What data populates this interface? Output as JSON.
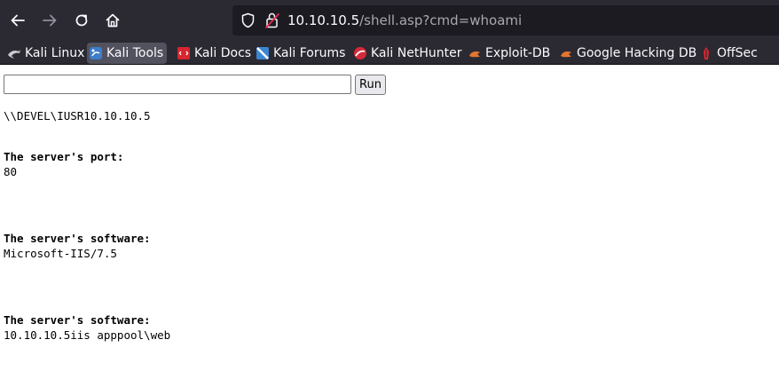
{
  "toolbar": {
    "back": "back-arrow",
    "forward": "forward-arrow",
    "reload": "reload",
    "home": "home",
    "url_host": "10.10.10.5",
    "url_path": "/shell.asp?cmd=whoami"
  },
  "bookmarks": [
    {
      "label": "Kali Linux",
      "icon": "kali-dragon-icon"
    },
    {
      "label": "Kali Tools",
      "icon": "kali-tools-icon",
      "active": true
    },
    {
      "label": "Kali Docs",
      "icon": "kali-docs-icon"
    },
    {
      "label": "Kali Forums",
      "icon": "kali-forums-icon"
    },
    {
      "label": "Kali NetHunter",
      "icon": "nethunter-icon"
    },
    {
      "label": "Exploit-DB",
      "icon": "exploit-db-icon"
    },
    {
      "label": "Google Hacking DB",
      "icon": "ghdb-icon"
    },
    {
      "label": "OffSec",
      "icon": "offsec-icon"
    }
  ],
  "page": {
    "input_value": "",
    "run_label": "Run",
    "whoami_output": "\\\\DEVEL\\IUSR10.10.10.5",
    "port_heading": "The server's port:",
    "port_value": "80",
    "software_heading": "The server's software:",
    "software_value": "Microsoft-IIS/7.5",
    "software_heading_2": "The server's software:",
    "software_value_2": "10.10.10.5iis apppool\\web"
  },
  "colors": {
    "chrome_bg": "#2b2a33",
    "urlbar_bg": "#1c1b22",
    "active_bookmark_bg": "#52525e"
  }
}
